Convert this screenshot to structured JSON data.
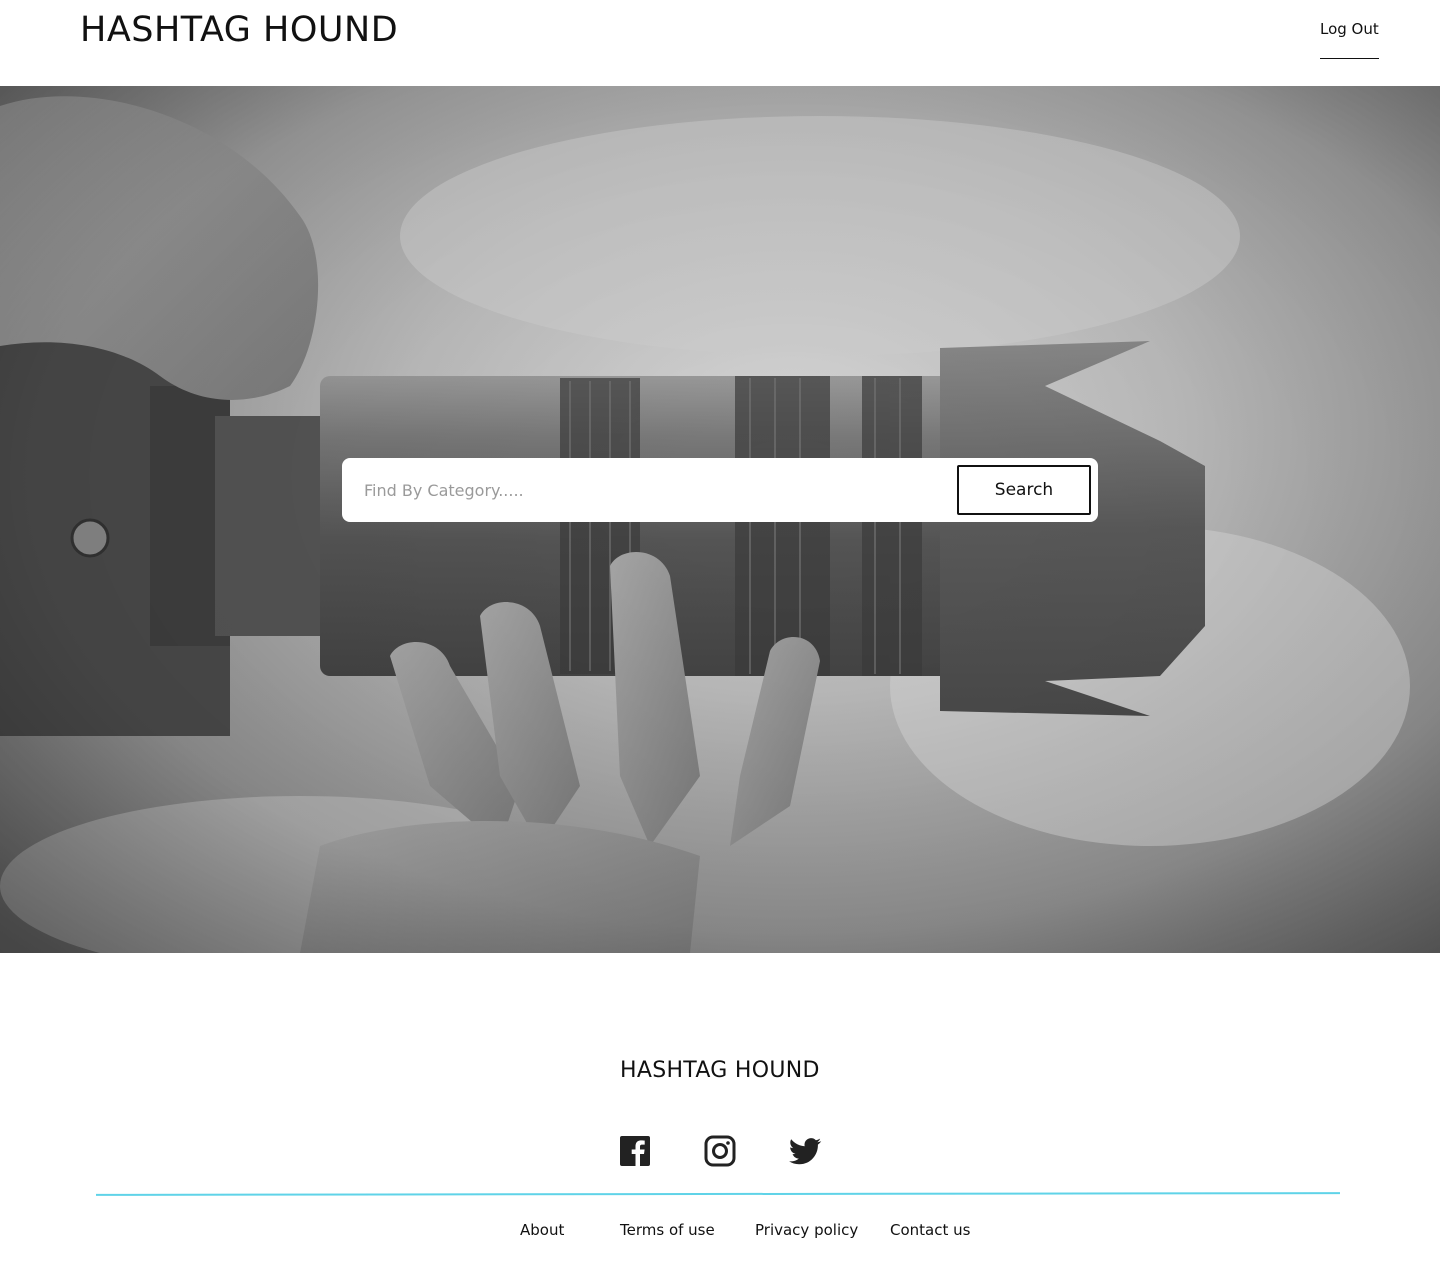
{
  "header": {
    "brand": "HASHTAG HOUND",
    "logout_label": "Log Out"
  },
  "search": {
    "placeholder": "Find By Category.....",
    "button_label": "Search"
  },
  "footer": {
    "brand": "HASHTAG HOUND",
    "social": [
      "facebook-icon",
      "instagram-icon",
      "twitter-icon"
    ],
    "divider_color": "#5fd3e8",
    "links": {
      "about": "About",
      "terms": "Terms of use",
      "privacy": "Privacy policy",
      "contact": "Contact us"
    }
  }
}
